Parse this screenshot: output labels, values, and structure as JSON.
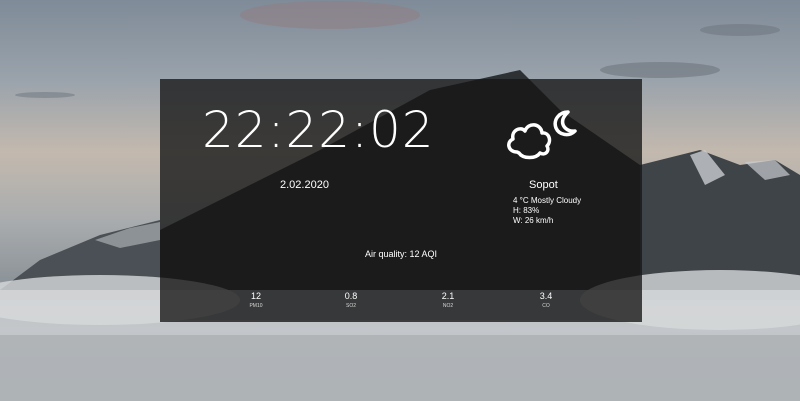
{
  "clock": {
    "time": "22:22:02"
  },
  "date": {
    "text": "2.02.2020"
  },
  "weather": {
    "icon": "cloud-moon-icon",
    "city": "Sopot",
    "condition": "4 °C Mostly Cloudy",
    "humidity": "H: 83%",
    "wind": "W: 26 km/h"
  },
  "air_quality": {
    "summary": "Air quality: 12 AQI",
    "pollutants": [
      {
        "value": "12",
        "label": "PM10"
      },
      {
        "value": "0.8",
        "label": "SO2"
      },
      {
        "value": "2.1",
        "label": "NO2"
      },
      {
        "value": "3.4",
        "label": "CO"
      }
    ]
  },
  "colors": {
    "panel_bg": "rgba(22,22,22,0.78)",
    "text": "#ffffff"
  }
}
